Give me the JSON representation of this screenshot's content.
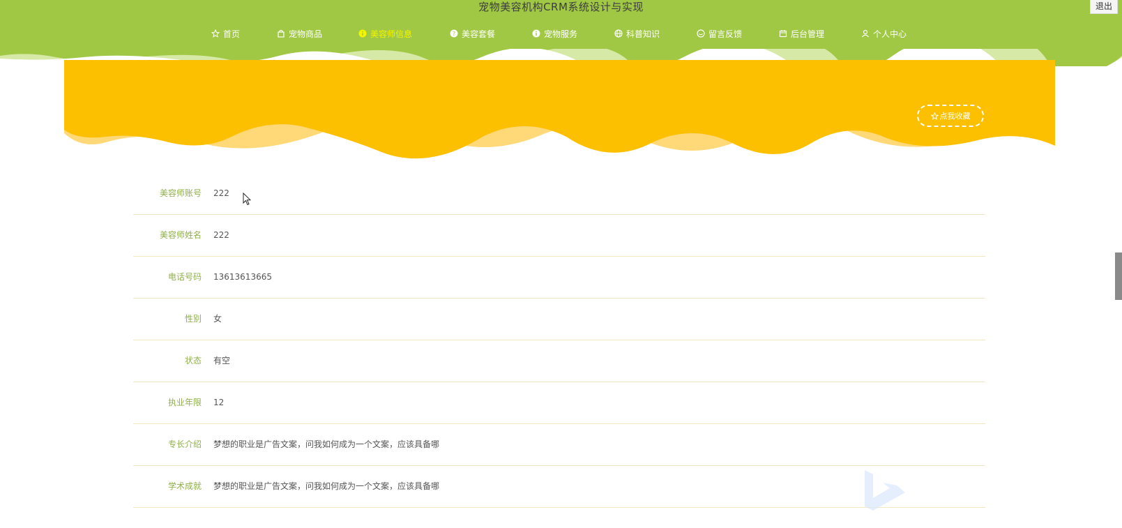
{
  "header": {
    "title": "宠物美容机构CRM系统设计与实现",
    "logout_label": "退出",
    "nav": [
      {
        "label": "首页",
        "icon": "star-icon"
      },
      {
        "label": "宠物商品",
        "icon": "bag-icon"
      },
      {
        "label": "美容师信息",
        "icon": "info-circle-icon",
        "active": true
      },
      {
        "label": "美容套餐",
        "icon": "question-circle-icon"
      },
      {
        "label": "宠物服务",
        "icon": "info-circle-icon"
      },
      {
        "label": "科普知识",
        "icon": "globe-icon"
      },
      {
        "label": "留言反馈",
        "icon": "smile-icon"
      },
      {
        "label": "后台管理",
        "icon": "calendar-icon"
      },
      {
        "label": "个人中心",
        "icon": "user-icon"
      }
    ]
  },
  "banner": {
    "favorite_label": "点我收藏",
    "favorite_icon": "star-outline-icon"
  },
  "detail": {
    "rows": [
      {
        "label": "美容师账号",
        "value": "222"
      },
      {
        "label": "美容师姓名",
        "value": "222"
      },
      {
        "label": "电话号码",
        "value": "13613613665"
      },
      {
        "label": "性别",
        "value": "女"
      },
      {
        "label": "状态",
        "value": "有空"
      },
      {
        "label": "执业年限",
        "value": "12"
      },
      {
        "label": "专长介绍",
        "value": "梦想的职业是广告文案，问我如何成为一个文案，应该具备哪"
      },
      {
        "label": "学术成就",
        "value": "梦想的职业是广告文案，问我如何成为一个文案，应该具备哪"
      }
    ]
  },
  "colors": {
    "header_bg": "#a0c844",
    "banner_bg": "#fdc000",
    "active_nav": "#f5f500",
    "label": "#8fb04d"
  }
}
